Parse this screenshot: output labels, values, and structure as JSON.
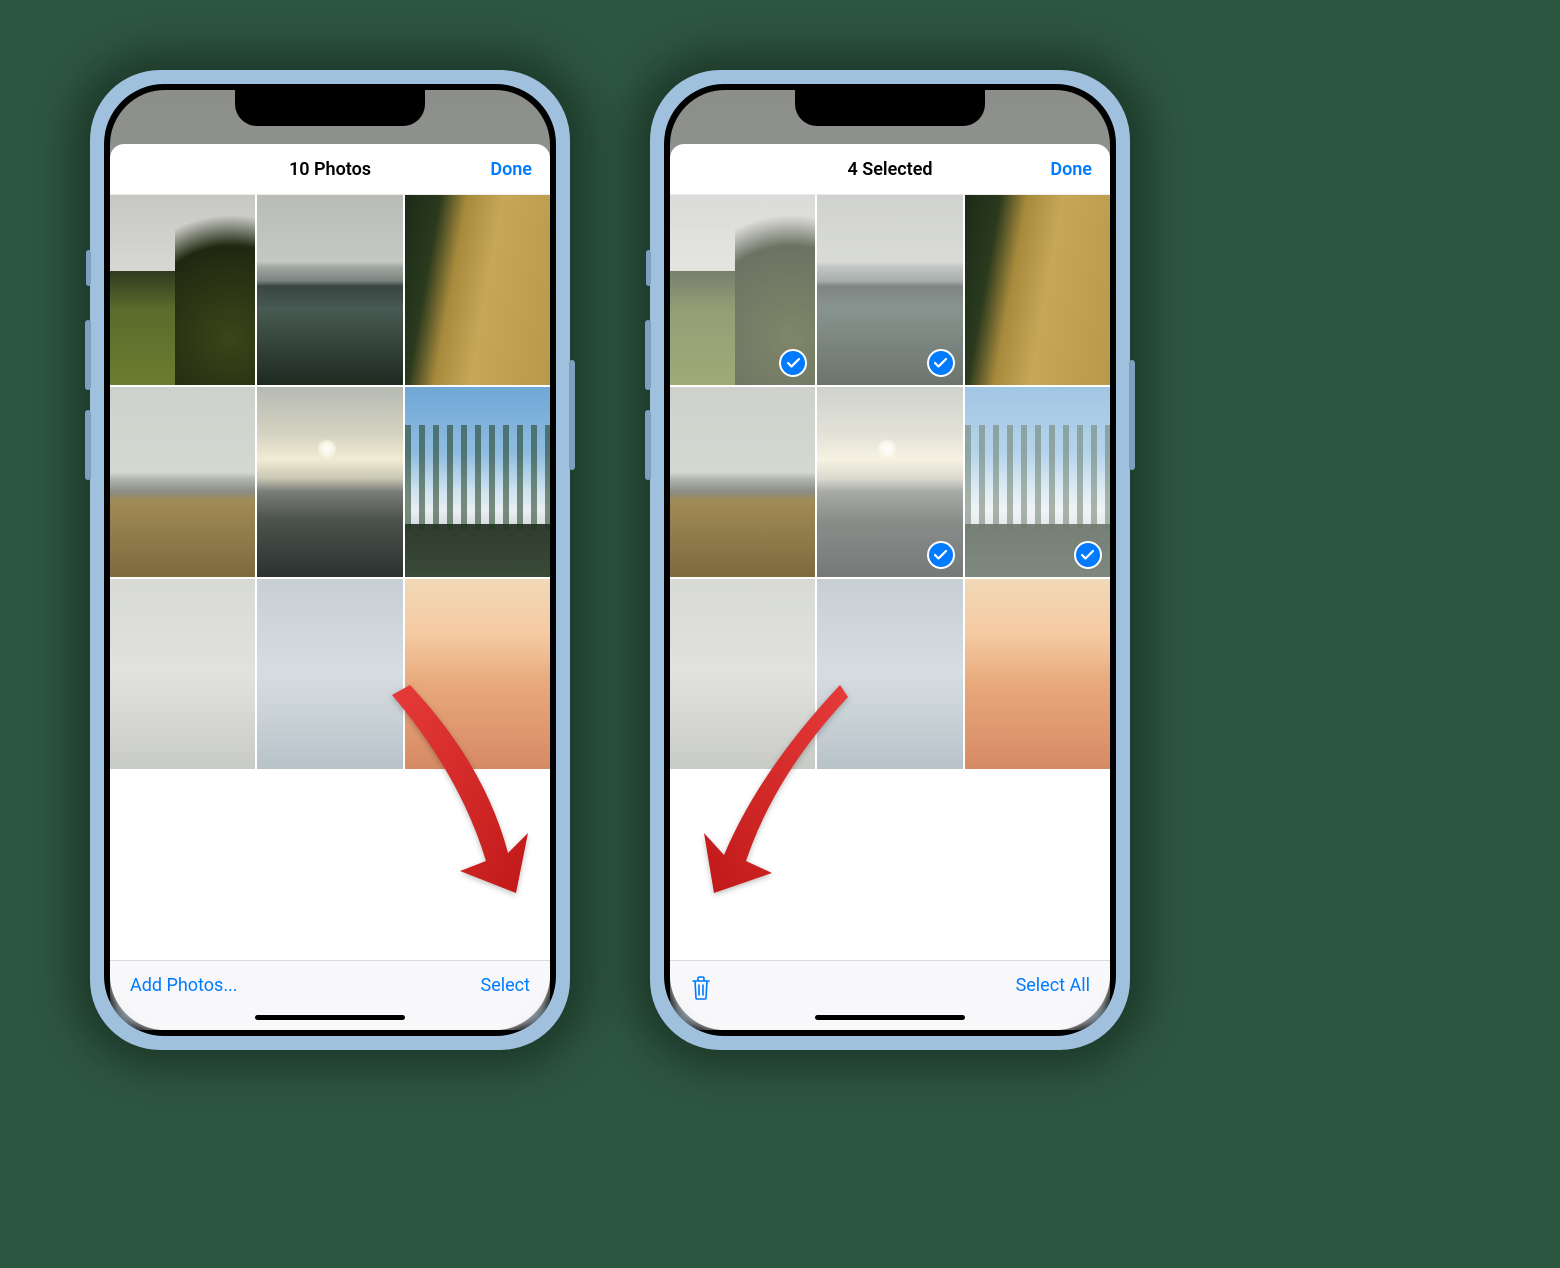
{
  "phones": {
    "left": {
      "title": "10 Photos",
      "done": "Done",
      "toolbar_left": "Add Photos...",
      "toolbar_right": "Select"
    },
    "right": {
      "title": "4 Selected",
      "done": "Done",
      "toolbar_right": "Select All"
    }
  },
  "photo_thumbnails": [
    "landscape-greenery-trees",
    "coastline-overcast",
    "tall-grass-pine",
    "reeds-shore",
    "sunset-rocky-beach",
    "pine-forest-snow",
    "clouds-grey",
    "sea-horizon",
    "orange-sunset"
  ],
  "right_selection": {
    "selected_indices": [
      0,
      1,
      4,
      5
    ]
  }
}
